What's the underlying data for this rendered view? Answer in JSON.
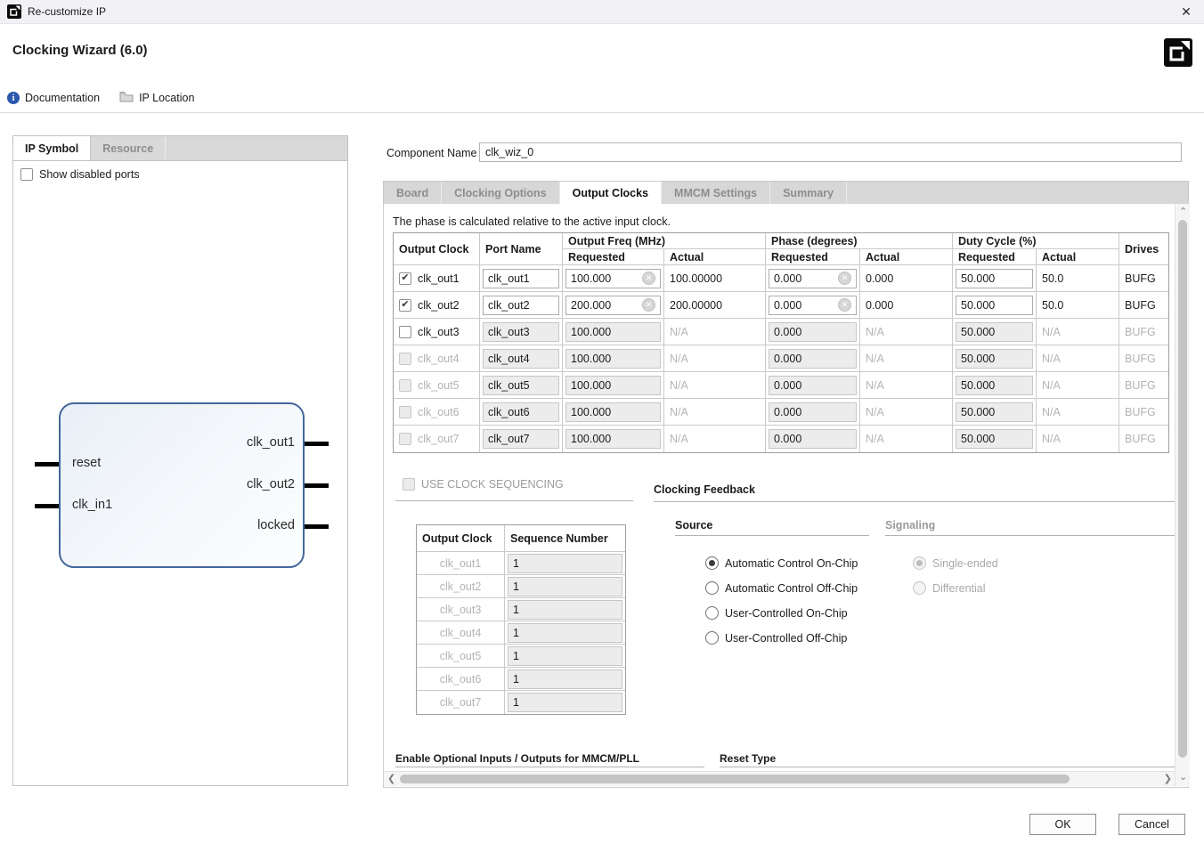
{
  "window": {
    "title": "Re-customize IP"
  },
  "icons": {
    "close": "✕",
    "check": "✔",
    "clear": "✕",
    "info": "i",
    "chevron_left": "❮",
    "chevron_right": "❯",
    "chevron_up": "⌃",
    "chevron_down": "⌄"
  },
  "header": {
    "title": "Clocking Wizard (6.0)"
  },
  "toolbar": {
    "documentation": "Documentation",
    "ip_location": "IP Location"
  },
  "left_panel": {
    "tabs": [
      {
        "label": "IP Symbol",
        "active": true
      },
      {
        "label": "Resource",
        "active": false
      }
    ],
    "show_disabled_ports": "Show disabled ports",
    "symbol": {
      "inputs": [
        "reset",
        "clk_in1"
      ],
      "outputs": [
        "clk_out1",
        "clk_out2",
        "locked"
      ]
    }
  },
  "component": {
    "label": "Component Name",
    "value": "clk_wiz_0"
  },
  "tabs": [
    {
      "label": "Board",
      "active": false
    },
    {
      "label": "Clocking Options",
      "active": false
    },
    {
      "label": "Output Clocks",
      "active": true
    },
    {
      "label": "MMCM Settings",
      "active": false
    },
    {
      "label": "Summary",
      "active": false
    }
  ],
  "output_clocks": {
    "note": "The phase is calculated relative to the active input clock.",
    "table": {
      "groups": {
        "freq": "Output Freq (MHz)",
        "phase": "Phase (degrees)",
        "duty": "Duty Cycle (%)"
      },
      "headers": {
        "output_clock": "Output Clock",
        "port_name": "Port Name",
        "requested": "Requested",
        "actual": "Actual",
        "drives": "Drives"
      },
      "rows": [
        {
          "name": "clk_out1",
          "checked": true,
          "checkbox_disabled": false,
          "editable": true,
          "port": "clk_out1",
          "freq_req": "100.000",
          "freq_act": "100.00000",
          "phase_req": "0.000",
          "phase_act": "0.000",
          "duty_req": "50.000",
          "duty_act": "50.0",
          "drives": "BUFG"
        },
        {
          "name": "clk_out2",
          "checked": true,
          "checkbox_disabled": false,
          "editable": true,
          "port": "clk_out2",
          "freq_req": "200.000",
          "freq_act": "200.00000",
          "phase_req": "0.000",
          "phase_act": "0.000",
          "duty_req": "50.000",
          "duty_act": "50.0",
          "drives": "BUFG"
        },
        {
          "name": "clk_out3",
          "checked": false,
          "checkbox_disabled": false,
          "editable": false,
          "port": "clk_out3",
          "freq_req": "100.000",
          "freq_act": "N/A",
          "phase_req": "0.000",
          "phase_act": "N/A",
          "duty_req": "50.000",
          "duty_act": "N/A",
          "drives": "BUFG"
        },
        {
          "name": "clk_out4",
          "checked": false,
          "checkbox_disabled": true,
          "editable": false,
          "port": "clk_out4",
          "freq_req": "100.000",
          "freq_act": "N/A",
          "phase_req": "0.000",
          "phase_act": "N/A",
          "duty_req": "50.000",
          "duty_act": "N/A",
          "drives": "BUFG"
        },
        {
          "name": "clk_out5",
          "checked": false,
          "checkbox_disabled": true,
          "editable": false,
          "port": "clk_out5",
          "freq_req": "100.000",
          "freq_act": "N/A",
          "phase_req": "0.000",
          "phase_act": "N/A",
          "duty_req": "50.000",
          "duty_act": "N/A",
          "drives": "BUFG"
        },
        {
          "name": "clk_out6",
          "checked": false,
          "checkbox_disabled": true,
          "editable": false,
          "port": "clk_out6",
          "freq_req": "100.000",
          "freq_act": "N/A",
          "phase_req": "0.000",
          "phase_act": "N/A",
          "duty_req": "50.000",
          "duty_act": "N/A",
          "drives": "BUFG"
        },
        {
          "name": "clk_out7",
          "checked": false,
          "checkbox_disabled": true,
          "editable": false,
          "port": "clk_out7",
          "freq_req": "100.000",
          "freq_act": "N/A",
          "phase_req": "0.000",
          "phase_act": "N/A",
          "duty_req": "50.000",
          "duty_act": "N/A",
          "drives": "BUFG"
        }
      ]
    },
    "use_clock_sequencing": "USE CLOCK SEQUENCING",
    "sequence_table": {
      "headers": [
        "Output Clock",
        "Sequence Number"
      ],
      "rows": [
        {
          "name": "clk_out1",
          "seq": "1"
        },
        {
          "name": "clk_out2",
          "seq": "1"
        },
        {
          "name": "clk_out3",
          "seq": "1"
        },
        {
          "name": "clk_out4",
          "seq": "1"
        },
        {
          "name": "clk_out5",
          "seq": "1"
        },
        {
          "name": "clk_out6",
          "seq": "1"
        },
        {
          "name": "clk_out7",
          "seq": "1"
        }
      ]
    },
    "clocking_feedback": {
      "title": "Clocking Feedback",
      "source": {
        "label": "Source",
        "options": [
          {
            "label": "Automatic Control On-Chip",
            "selected": true,
            "disabled": false
          },
          {
            "label": "Automatic Control Off-Chip",
            "selected": false,
            "disabled": false
          },
          {
            "label": "User-Controlled On-Chip",
            "selected": false,
            "disabled": false
          },
          {
            "label": "User-Controlled Off-Chip",
            "selected": false,
            "disabled": false
          }
        ]
      },
      "signaling": {
        "label": "Signaling",
        "options": [
          {
            "label": "Single-ended",
            "selected": true,
            "disabled": true
          },
          {
            "label": "Differential",
            "selected": false,
            "disabled": true
          }
        ]
      }
    },
    "sections": {
      "optional_io": "Enable Optional Inputs / Outputs for MMCM/PLL",
      "reset_type": "Reset Type"
    }
  },
  "footer": {
    "ok": "OK",
    "cancel": "Cancel"
  }
}
